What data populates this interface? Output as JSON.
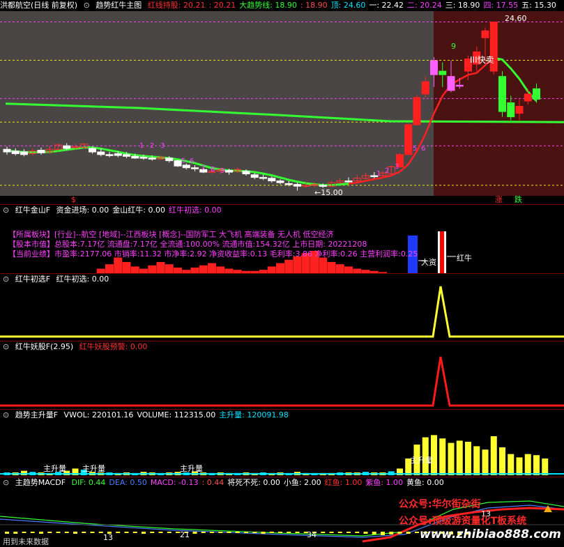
{
  "main_header": {
    "stock": "洪都航空(日线 前复权)",
    "indicator": "趋势红牛主图",
    "items": [
      {
        "label": "红线持股:",
        "value": "20.21",
        "color": "#ff3030"
      },
      {
        "label": ":",
        "value": "20.21",
        "color": "#ff3030"
      },
      {
        "label": "大趋势线:",
        "value": "18.90",
        "color": "#33ff33"
      },
      {
        "label": ":",
        "value": "18.90",
        "color": "#ff5050"
      },
      {
        "label": "顶:",
        "value": "24.60",
        "color": "#00e5ff"
      },
      {
        "label": "一:",
        "value": "22.42",
        "color": "#ffffff"
      },
      {
        "label": "二:",
        "value": "20.24",
        "color": "#ff40ff"
      },
      {
        "label": "三:",
        "value": "18.90",
        "color": "#ffffff"
      },
      {
        "label": "四:",
        "value": "17.55",
        "color": "#ff40ff"
      },
      {
        "label": "五:",
        "value": "15.30",
        "color": "#ffffff"
      }
    ]
  },
  "main_annotations": {
    "high": "24.60",
    "low": "←15.00",
    "sell": "卖",
    "fast_sell": "III快卖",
    "nine_top": "9",
    "zhang": "涨",
    "die": "跌",
    "dollar": "$"
  },
  "jinshan": {
    "title": "红牛金山F",
    "fields": [
      {
        "label": "资金进场:",
        "value": "0.00",
        "color": "#ffffff"
      },
      {
        "label": "金山红牛:",
        "value": "0.00",
        "color": "#ffffff"
      },
      {
        "label": "红牛初选:",
        "value": "0.00",
        "color": "#ff40ff"
      }
    ],
    "info_lines": [
      "【所属板块】[行业]--航空 [地域]--江西板块 [概念]--国防军工 大飞机 高端装备 无人机 低空经济",
      "【股本市值】总股本:7.17亿 流通盘:7.17亿 全流通:100.00% 流通市值:154.32亿 上市日期: 20221208",
      "【当前业绩】市盈率:2177.06 市销率:11.32 市净率:2.92 净资收益率:0.13 毛利率:3.86 净利率:0.26 主营利润率:0.25"
    ],
    "da_zi": "大资",
    "hong_niu": "红牛"
  },
  "chuxuan": {
    "title": "红牛初选F",
    "fields": [
      {
        "label": "红牛初选:",
        "value": "0.00",
        "color": "#ffffff"
      }
    ]
  },
  "yaogu": {
    "title": "红牛妖股F(2.95)",
    "fields": [
      {
        "label": "红牛妖股预警:",
        "value": "0.00",
        "color": "#ff3030"
      }
    ]
  },
  "shengliang": {
    "title": "趋势主升量F",
    "fields": [
      {
        "label": "VWOL:",
        "value": "220101.16",
        "color": "#ffffff"
      },
      {
        "label": "VOLUME:",
        "value": "112315.00",
        "color": "#ffffff"
      },
      {
        "label": "主升量:",
        "value": "120091.98",
        "color": "#00e5ff"
      }
    ],
    "zhu_sheng_label": "主升量"
  },
  "macd": {
    "title": "主趋势MACDF",
    "fields": [
      {
        "label": "DIF:",
        "value": "0.44",
        "color": "#33ff33"
      },
      {
        "label": "DEA:",
        "value": "0.50",
        "color": "#4a7dff"
      },
      {
        "label": "MACD:",
        "value": "-0.13",
        "color": "#ff40ff"
      },
      {
        "label": ":",
        "value": "0.44",
        "color": "#ff5050"
      },
      {
        "label": "将死不死:",
        "value": "0.00",
        "color": "#ffffff"
      },
      {
        "label": "小鱼:",
        "value": "2.00",
        "color": "#ffffff"
      },
      {
        "label": "红鱼:",
        "value": "1.00",
        "color": "#ff3030"
      },
      {
        "label": "紫鱼:",
        "value": "1.00",
        "color": "#ff40ff"
      },
      {
        "label": "黄鱼:",
        "value": "0.00",
        "color": "#ffffff"
      }
    ],
    "numbers": [
      "13",
      "21",
      "34",
      "13"
    ],
    "future_note": "用到未来数据",
    "watermark1": "公众号:华尔街杂街",
    "watermark2": "公众号:顶级游资量化T板系统",
    "watermark3": "www.zhibiao888.com"
  },
  "colors": {
    "up": "#ff2020",
    "down_fill": "#ffffff",
    "green": "#33ff33",
    "red_line": "#ff2020",
    "bg_gray": "#4a4646",
    "bg_brown": "#4a1210",
    "yellow": "#ffff30",
    "magenta": "#ff40ff",
    "cyan": "#00e5ff"
  },
  "chart_data": {
    "type": "candlestick",
    "price_axis_levels": [
      24.6,
      22.42,
      20.24,
      18.9,
      17.55,
      15.3
    ],
    "candles": [
      {
        "o": 17.35,
        "c": 17.2,
        "h": 17.5,
        "l": 17.05
      },
      {
        "o": 17.25,
        "c": 17.1,
        "h": 17.4,
        "l": 17.0
      },
      {
        "o": 17.2,
        "c": 17.05,
        "h": 17.35,
        "l": 16.95
      },
      {
        "o": 17.1,
        "c": 17.25,
        "h": 17.4,
        "l": 17.0
      },
      {
        "o": 17.3,
        "c": 17.15,
        "h": 17.45,
        "l": 17.05
      },
      {
        "o": 17.2,
        "c": 17.35,
        "h": 17.55,
        "l": 17.1
      },
      {
        "o": 17.35,
        "c": 17.6,
        "h": 17.7,
        "l": 17.25
      },
      {
        "o": 17.55,
        "c": 17.4,
        "h": 17.7,
        "l": 17.3
      },
      {
        "o": 17.45,
        "c": 17.5,
        "h": 17.65,
        "l": 17.35
      },
      {
        "o": 17.45,
        "c": 17.65,
        "h": 17.7,
        "l": 17.4
      },
      {
        "o": 17.4,
        "c": 17.2,
        "h": 17.5,
        "l": 17.1
      },
      {
        "o": 17.2,
        "c": 17.05,
        "h": 17.4,
        "l": 16.95
      },
      {
        "o": 17.05,
        "c": 17.0,
        "h": 17.2,
        "l": 16.9
      },
      {
        "o": 17.1,
        "c": 17.0,
        "h": 17.25,
        "l": 16.9
      },
      {
        "o": 17.05,
        "c": 16.95,
        "h": 17.2,
        "l": 16.85
      },
      {
        "o": 16.95,
        "c": 16.85,
        "h": 17.1,
        "l": 16.8
      },
      {
        "o": 16.9,
        "c": 16.85,
        "h": 17.05,
        "l": 16.75
      },
      {
        "o": 16.85,
        "c": 16.8,
        "h": 17.0,
        "l": 16.7
      },
      {
        "o": 16.8,
        "c": 16.9,
        "h": 17.0,
        "l": 16.75
      },
      {
        "o": 16.85,
        "c": 16.7,
        "h": 16.95,
        "l": 16.6
      },
      {
        "o": 16.7,
        "c": 16.4,
        "h": 16.75,
        "l": 16.35
      },
      {
        "o": 16.45,
        "c": 16.3,
        "h": 16.55,
        "l": 16.2
      },
      {
        "o": 16.3,
        "c": 16.25,
        "h": 16.45,
        "l": 16.1
      },
      {
        "o": 16.2,
        "c": 16.05,
        "h": 16.3,
        "l": 16.0
      },
      {
        "o": 16.05,
        "c": 16.1,
        "h": 16.25,
        "l": 15.95
      },
      {
        "o": 16.1,
        "c": 16.2,
        "h": 16.3,
        "l": 15.95
      },
      {
        "o": 16.15,
        "c": 16.05,
        "h": 16.25,
        "l": 15.9
      },
      {
        "o": 16.1,
        "c": 16.2,
        "h": 16.3,
        "l": 16.0
      },
      {
        "o": 16.1,
        "c": 15.95,
        "h": 16.2,
        "l": 15.85
      },
      {
        "o": 15.9,
        "c": 15.75,
        "h": 16.0,
        "l": 15.65
      },
      {
        "o": 15.75,
        "c": 15.7,
        "h": 15.9,
        "l": 15.6
      },
      {
        "o": 15.7,
        "c": 15.55,
        "h": 15.8,
        "l": 15.45
      },
      {
        "o": 15.55,
        "c": 15.45,
        "h": 15.65,
        "l": 15.35
      },
      {
        "o": 15.4,
        "c": 15.35,
        "h": 15.55,
        "l": 15.25
      },
      {
        "o": 15.35,
        "c": 15.25,
        "h": 15.45,
        "l": 15.0
      },
      {
        "o": 15.25,
        "c": 15.3,
        "h": 15.45,
        "l": 15.15
      },
      {
        "o": 15.3,
        "c": 15.35,
        "h": 15.5,
        "l": 15.2
      },
      {
        "o": 15.3,
        "c": 15.25,
        "h": 15.4,
        "l": 15.15
      },
      {
        "o": 15.25,
        "c": 15.45,
        "h": 15.55,
        "l": 15.2
      },
      {
        "o": 15.45,
        "c": 15.55,
        "h": 15.7,
        "l": 15.4
      },
      {
        "o": 15.55,
        "c": 15.5,
        "h": 15.75,
        "l": 15.45
      },
      {
        "o": 15.55,
        "c": 15.7,
        "h": 15.9,
        "l": 15.5
      },
      {
        "o": 15.7,
        "c": 15.85,
        "h": 16.0,
        "l": 15.65
      },
      {
        "o": 15.85,
        "c": 15.8,
        "h": 16.05,
        "l": 15.7
      },
      {
        "o": 15.85,
        "c": 16.0,
        "h": 16.1,
        "l": 15.8
      },
      {
        "o": 15.95,
        "c": 16.35,
        "h": 16.45,
        "l": 15.9
      },
      {
        "o": 16.35,
        "c": 17.05,
        "h": 17.15,
        "l": 16.3
      },
      {
        "o": 17.05,
        "c": 18.75,
        "h": 18.8,
        "l": 17.0
      },
      {
        "o": 18.75,
        "c": 20.3,
        "h": 20.45,
        "l": 18.7
      },
      {
        "o": 20.5,
        "c": 21.2,
        "h": 21.5,
        "l": 20.3
      },
      {
        "o": 21.6,
        "c": 22.4,
        "h": 22.6,
        "l": 20.9
      },
      {
        "o": 21.8,
        "c": 21.6,
        "h": 22.3,
        "l": 20.9
      },
      {
        "o": 20.7,
        "c": 21.5,
        "h": 22.4,
        "l": 20.6
      },
      {
        "o": 21.0,
        "c": 21.0,
        "h": 21.4,
        "l": 20.8
      },
      {
        "o": 21.8,
        "c": 22.5,
        "h": 22.7,
        "l": 21.3
      },
      {
        "o": 22.2,
        "c": 22.9,
        "h": 23.2,
        "l": 21.8
      },
      {
        "o": 23.7,
        "c": 24.1,
        "h": 24.3,
        "l": 22.2
      },
      {
        "o": 21.8,
        "c": 24.6,
        "h": 24.6,
        "l": 21.6
      },
      {
        "o": 21.5,
        "c": 19.5,
        "h": 21.8,
        "l": 19.2
      },
      {
        "o": 20.0,
        "c": 19.2,
        "h": 20.4,
        "l": 19.0
      },
      {
        "o": 19.4,
        "c": 19.8,
        "h": 20.2,
        "l": 19.0
      },
      {
        "o": 20.1,
        "c": 20.5,
        "h": 20.8,
        "l": 19.9
      },
      {
        "o": 20.8,
        "c": 20.2,
        "h": 21.1,
        "l": 20.0
      }
    ]
  }
}
